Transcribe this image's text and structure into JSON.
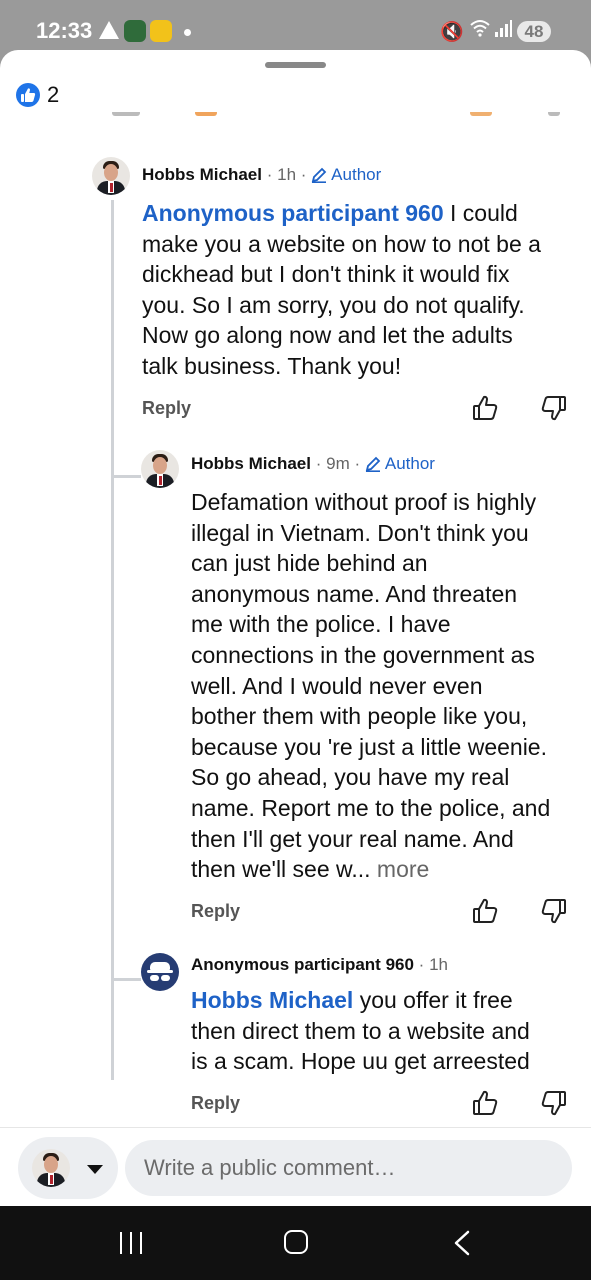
{
  "status_bar": {
    "time": "12:33",
    "battery": "48"
  },
  "reactions": {
    "count": "2"
  },
  "comments": [
    {
      "author": "Hobbs Michael",
      "separator": "·",
      "time": "1h",
      "badge": "Author",
      "mention": "Anonymous participant 960",
      "lines": [
        " I could",
        "make you a website on how to not be a",
        "dickhead but I don't think it would fix",
        "you. So I am sorry, you do not qualify.",
        "Now go along now and let the adults",
        "talk business. Thank you!"
      ],
      "reply_label": "Reply"
    },
    {
      "author": "Hobbs Michael",
      "separator": "·",
      "time": "9m",
      "badge": "Author",
      "lines": [
        "Defamation without proof is highly",
        "illegal in Vietnam. Don't think you",
        "can just hide behind an",
        "anonymous name. And threaten",
        "me with the police. I have",
        "connections in the government as",
        "well. And I would never even",
        "bother them with people like you,",
        "because you 're just a little weenie.",
        "So go ahead, you have my real",
        "name. Report me to the police, and",
        "then I'll get your real name. And",
        "then we'll see w..."
      ],
      "more_label": " more",
      "reply_label": "Reply"
    },
    {
      "author": "Anonymous participant 960",
      "separator": "·",
      "time": "1h",
      "mention": "Hobbs Michael",
      "lines": [
        " you offer it free",
        "then direct them to a website and",
        "is a scam.  Hope uu get arreested"
      ],
      "reply_label": "Reply"
    }
  ],
  "composer": {
    "placeholder": "Write a public comment…"
  }
}
